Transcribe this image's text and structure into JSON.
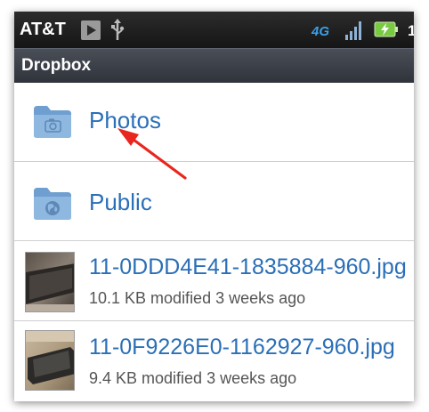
{
  "status_bar": {
    "carrier": "AT&T",
    "network": "4G",
    "icons": [
      "play-store-icon",
      "usb-icon",
      "network-4g-icon",
      "signal-icon",
      "battery-charging-icon"
    ]
  },
  "app_bar": {
    "title": "Dropbox"
  },
  "list": {
    "folders": [
      {
        "name": "Photos",
        "icon": "folder-camera-icon"
      },
      {
        "name": "Public",
        "icon": "folder-globe-icon"
      }
    ],
    "files": [
      {
        "name": "11-0DDD4E41-1835884-960.jpg",
        "meta": "10.1 KB modified 3 weeks ago"
      },
      {
        "name": "11-0F9226E0-1162927-960.jpg",
        "meta": "9.4 KB modified 3 weeks ago"
      }
    ]
  },
  "colors": {
    "link_blue": "#2a6fb8",
    "annotation_red": "#e8261f",
    "battery_green": "#7ac943",
    "network_blue": "#3aa0e8"
  }
}
